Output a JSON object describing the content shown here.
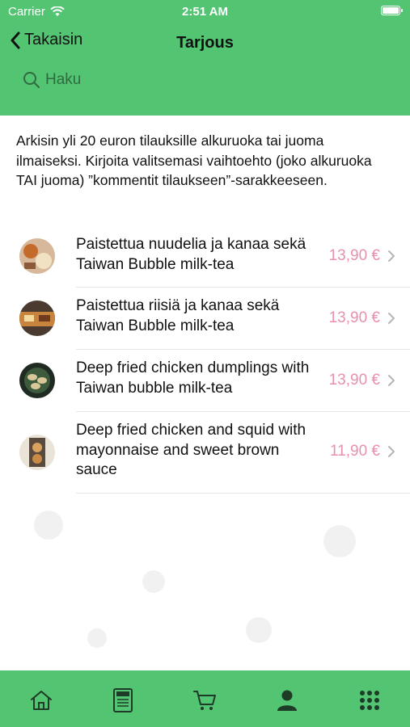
{
  "status_bar": {
    "carrier": "Carrier",
    "time": "2:51 AM"
  },
  "nav": {
    "back_label": "Takaisin",
    "title": "Tarjous"
  },
  "search": {
    "placeholder": "Haku"
  },
  "notice": "Arkisin yli 20 euron tilauksille alkuruoka tai juoma ilmaiseksi. Kirjoita valitsemasi vaihtoehto (joko alkuruoka TAI juoma) ”kommentit tilaukseen”-sarakkeeseen.",
  "items": [
    {
      "name": "Paistettua nuudelia ja kanaa sekä Taiwan Bubble milk-tea",
      "price": "13,90 €"
    },
    {
      "name": "Paistettua riisiä ja kanaa sekä Taiwan Bubble milk-tea",
      "price": "13,90 €"
    },
    {
      "name": "Deep fried chicken dumplings with Taiwan bubble milk-tea",
      "price": "13,90 €"
    },
    {
      "name": "Deep fried chicken and squid with mayonnaise and sweet brown sauce",
      "price": "11,90 €"
    }
  ],
  "tabbar": {
    "icons": [
      "home-icon",
      "menu-icon",
      "cart-icon",
      "profile-icon",
      "grid-icon"
    ]
  },
  "colors": {
    "brand_green": "#52c472",
    "price_pink": "#e98fb0"
  }
}
